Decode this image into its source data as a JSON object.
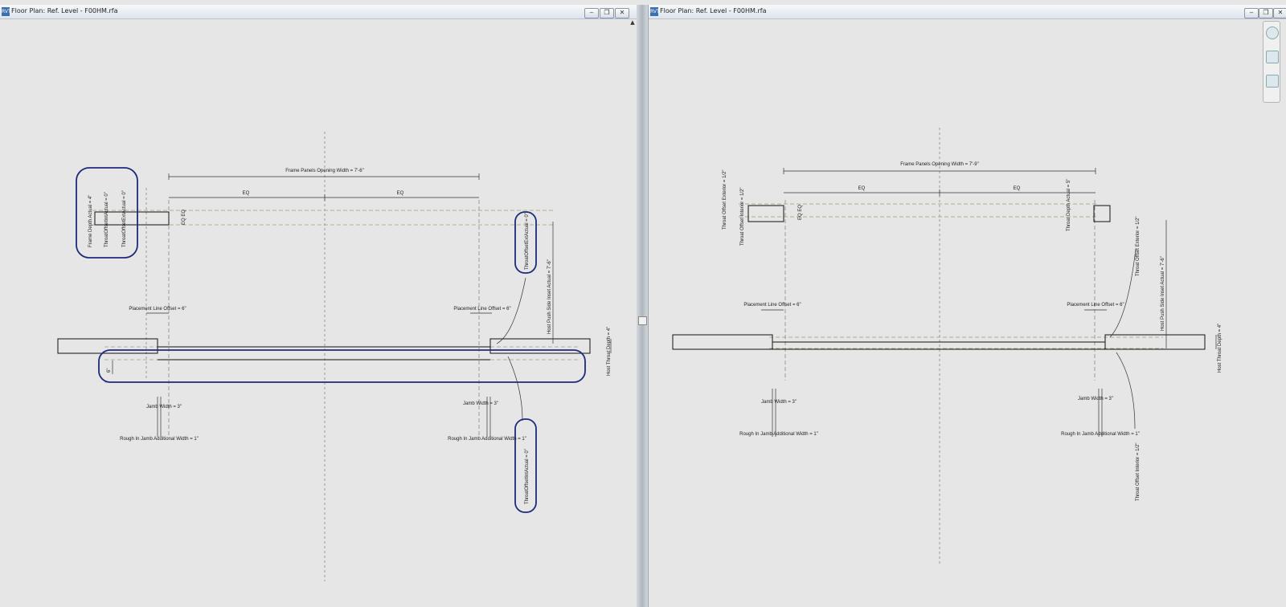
{
  "left_window": {
    "title": "Floor Plan: Ref. Level - F00HM.rfa",
    "file_icon": "RVT",
    "buttons": {
      "minimize": "‒",
      "restore": "❐",
      "close": "✕"
    },
    "labels": {
      "frame_panels_opening": "Frame Panels Opening Width = 7'-6\"",
      "eq1": "EQ",
      "eq2": "EQ",
      "frame_depth_actual": "Frame Depth Actual = 4\"",
      "throat_offset_int_actual": "ThroatOffsetIntActual = 0\"",
      "throat_offset_ext_actual_top": "ThroatOffsetExtActual = 0\"",
      "eq_eq": "EQ EQ",
      "throat_offset_ext_actual_right": "ThroatOffsetExtActual = 0\"",
      "host_push_side_inset": "Host Push Side Inset Actual = 7'-6\"",
      "placement_left": "Placement Line Offset = 6\"",
      "placement_right": "Placement Line Offset = 6\"",
      "host_throat_depth": "Host Throat Depth = 4\"",
      "dim_6": "6\"",
      "jamb_left": "Jamb Width = 3\"",
      "jamb_right": "Jamb Width = 3\"",
      "rough_left": "Rough In Jamb Additional Width = 1\"",
      "rough_right": "Rough In Jamb Additional Width = 1\"",
      "throat_offset_int_actual_bottom": "ThroatOffsetIntActual = 0\""
    }
  },
  "right_window": {
    "title": "Floor Plan: Ref. Level - F00HM.rfa",
    "file_icon": "RVT",
    "buttons": {
      "minimize": "‒",
      "restore": "❐",
      "close": "✕"
    },
    "labels": {
      "frame_panels_opening": "Frame Panels Opening Width = 7'-9\"",
      "eq1": "EQ",
      "eq2": "EQ",
      "throat_offset_exterior_left": "Throat Offset Exterior = 1/2\"",
      "throat_offset_interior_left": "Throat Offset Interior = 1/2\"",
      "eq_eq": "EQ EQ",
      "throat_depth_actual": "Throat Depth Actual = 5\"",
      "throat_offset_exterior_right": "Throat Offset Exterior = 1/2\"",
      "host_push_side_inset": "Host Push Side Inset Actual = 7'-6\"",
      "placement_left": "Placement Line Offset = 6\"",
      "placement_right": "Placement Line Offset = 6\"",
      "host_throat_depth": "Host Throat Depth = 4\"",
      "jamb_left": "Jamb Width = 3\"",
      "jamb_right": "Jamb Width = 3\"",
      "rough_left": "Rough In Jamb Additional Width = 1\"",
      "rough_right": "Rough In Jamb Additional Width = 1\"",
      "throat_offset_interior_right": "Throat Offset Interior = 1/2\""
    }
  },
  "colors": {
    "highlight": "#1d2a7a",
    "line": "#111111",
    "dim": "#333333",
    "dash": "#7a7a7a"
  }
}
